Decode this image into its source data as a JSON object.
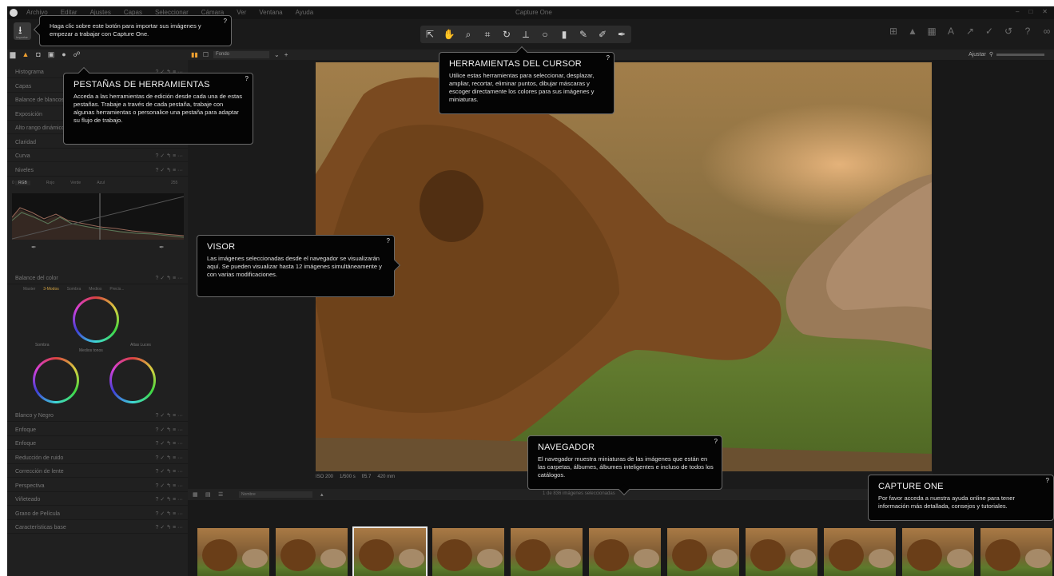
{
  "window": {
    "title": "Capture One",
    "menus": [
      "Archivo",
      "Editar",
      "Ajustes",
      "Capas",
      "Seleccionar",
      "Cámara",
      "Ver",
      "Ventana",
      "Ayuda"
    ],
    "controls": [
      "–",
      "□",
      "✕"
    ]
  },
  "toolbar": {
    "import_icon": "download-icon",
    "import_label": "Importar",
    "cursor_tools": [
      {
        "icon": "pointer-select-icon",
        "glyph": "⇱"
      },
      {
        "icon": "pan-hand-icon",
        "glyph": "✋"
      },
      {
        "icon": "zoom-icon",
        "glyph": "⌕"
      },
      {
        "icon": "crop-icon",
        "glyph": "⌗"
      },
      {
        "icon": "rotate-icon",
        "glyph": "↻"
      },
      {
        "icon": "keystone-icon",
        "glyph": "⟂"
      },
      {
        "icon": "spot-removal-icon",
        "glyph": "○"
      },
      {
        "icon": "white-balance-picker-icon",
        "glyph": "▮"
      },
      {
        "icon": "mask-brush-icon",
        "glyph": "✎"
      },
      {
        "icon": "mask-erase-icon",
        "glyph": "✐"
      },
      {
        "icon": "annotate-icon",
        "glyph": "✒"
      }
    ],
    "right_tools": [
      {
        "icon": "grid-icon",
        "glyph": "⊞"
      },
      {
        "icon": "exposure-warning-icon",
        "glyph": "▲"
      },
      {
        "icon": "copy-icon",
        "glyph": "▦"
      },
      {
        "icon": "text-icon",
        "glyph": "A"
      },
      {
        "icon": "apply-adjustments-icon",
        "glyph": "↗"
      },
      {
        "icon": "copy-apply-icon",
        "glyph": "✓"
      },
      {
        "icon": "reset-icon",
        "glyph": "↺"
      },
      {
        "icon": "help-icon",
        "glyph": "?"
      },
      {
        "icon": "proof-glasses-icon",
        "glyph": "∞"
      }
    ]
  },
  "tool_tabs": [
    {
      "icon": "library-tab-icon",
      "glyph": "▆"
    },
    {
      "icon": "exposure-tab-icon",
      "glyph": "▲"
    },
    {
      "icon": "camera-tab-icon",
      "glyph": "◘"
    },
    {
      "icon": "lens-tab-icon",
      "glyph": "▣"
    },
    {
      "icon": "color-tab-icon",
      "glyph": "●"
    },
    {
      "icon": "details-tab-icon",
      "glyph": "☍"
    }
  ],
  "viewer_bar": {
    "background_select": "Fondo",
    "adjust_label": "Ajustar"
  },
  "left_panel": {
    "sections_top": [
      "Histograma",
      "Capas",
      "Balance de blancos",
      "Exposición",
      "Alto rango dinámico",
      "Claridad",
      "Curva",
      "Niveles"
    ],
    "levels_tabs": [
      "RGB",
      "Rojo",
      "Verde",
      "Azul"
    ],
    "levels_values": [
      "0",
      "255"
    ],
    "color_balance": "Balance del color",
    "color_tabs": [
      "Master",
      "3-Modos",
      "Sombra",
      "Medios",
      "Precis..."
    ],
    "wheel_labels": [
      "Sombra",
      "Medios tonos",
      "Altas Luces"
    ],
    "sections_bottom": [
      "Blanco y Negro",
      "Enfoque",
      "Enfoque",
      "Reducción de ruido",
      "Corrección de lente",
      "Perspectiva",
      "Viñeteado",
      "Grano de Película",
      "Características base"
    ]
  },
  "photo_info": [
    "ISO 200",
    "1/500 s",
    "f/5.7",
    "420 mm"
  ],
  "browser": {
    "sort_label": "Nombre",
    "count_text": "1 de 836 imágenes seleccionadas",
    "thumbnails": 11,
    "selected_index": 2
  },
  "callouts": {
    "import": {
      "text": "Haga clic sobre este botón para importar sus imágenes y empezar a trabajar con Capture One.",
      "help": "?"
    },
    "tool_tabs": {
      "title": "PESTAÑAS DE HERRAMIENTAS",
      "text": "Acceda a las herramientas de edición desde cada una de estas pestañas. Trabaje a través de cada pestaña, trabaje con algunas herramientas o personalice una pestaña para adaptar su flujo de trabajo.",
      "help": "?"
    },
    "cursor_tools": {
      "title": "HERRAMIENTAS DEL CURSOR",
      "text": "Utilice estas herramientas para seleccionar, desplazar, ampliar, recortar, eliminar puntos, dibujar máscaras y escoger directamente los colores para sus imágenes y miniaturas.",
      "help": "?"
    },
    "viewer": {
      "title": "VISOR",
      "text": "Las imágenes seleccionadas desde el navegador se visualizarán aquí. Se pueden visualizar hasta 12 imágenes simultáneamente y con varias modificaciones.",
      "help": "?"
    },
    "navigator": {
      "title": "NAVEGADOR",
      "text": "El navegador muestra miniaturas de las imágenes que están en las carpetas, álbumes, álbumes inteligentes e incluso de todos los catálogos.",
      "help": "?"
    },
    "capture_one": {
      "title": "CAPTURE ONE",
      "text": "Por favor acceda a nuestra ayuda online para tener información más detallada, consejos y tutoriales.",
      "help": "?"
    }
  },
  "colors": {
    "accent": "#f0a030",
    "background": "#1b1b1b",
    "panel": "#202020",
    "tooltip_bg": "#040404"
  }
}
